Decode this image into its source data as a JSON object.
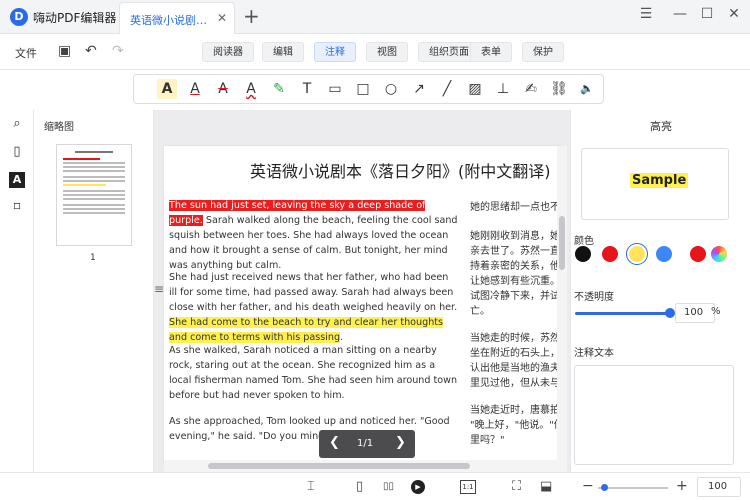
{
  "app": {
    "name": "嗨动PDF编辑器",
    "logo": "D"
  },
  "tab": {
    "title": "英语微小说剧本.p...",
    "close": "✕",
    "new_tab": "+"
  },
  "window": {
    "menu": "☰",
    "minimize": "—",
    "maximize": "☐",
    "close": "✕"
  },
  "menubar": {
    "file": "文件",
    "save_icon": "▣",
    "undo_icon": "↶",
    "redo_icon": "↷",
    "views": [
      "阅读器",
      "编辑",
      "注释",
      "视图",
      "组织页面",
      "表单",
      "保护"
    ],
    "active_view": "注释"
  },
  "tools": [
    {
      "icon": "A",
      "name": "highlight-tool"
    },
    {
      "icon": "A",
      "name": "underline-tool"
    },
    {
      "icon": "A",
      "name": "strikethrough-tool"
    },
    {
      "icon": "A",
      "name": "squiggly-tool"
    },
    {
      "icon": "✎",
      "name": "pencil-tool"
    },
    {
      "icon": "T",
      "name": "text-tool"
    },
    {
      "icon": "▭",
      "name": "comment-tool"
    },
    {
      "icon": "□",
      "name": "rectangle-tool"
    },
    {
      "icon": "○",
      "name": "circle-tool"
    },
    {
      "icon": "↗",
      "name": "arrow-tool"
    },
    {
      "icon": "╱",
      "name": "line-tool"
    },
    {
      "icon": "▨",
      "name": "image-tool"
    },
    {
      "icon": "⊥",
      "name": "stamp-tool"
    },
    {
      "icon": "✍",
      "name": "signature-tool"
    },
    {
      "icon": "⛓",
      "name": "link-tool"
    },
    {
      "icon": "🔈",
      "name": "audio-tool"
    }
  ],
  "left_sidebar": {
    "icons": [
      "⌕",
      "▯",
      "A",
      "⌑"
    ],
    "thumbnail_title": "缩略图",
    "thumbnail_page": "1"
  },
  "document": {
    "title": "英语微小说剧本《落日夕阳》(附中文翻译)",
    "para1_red": "The sun had just set, leaving the sky a deep shade of purple.",
    "para1_rest": " Sarah walked along the beach, feeling the cool sand squish between her toes. She had always loved the ocean and how it brought a sense of calm. But tonight, her mind was anything but calm.",
    "para2_plain": "She had just received news that her father, who had been ill for some time, had passed away. Sarah had always been close with her father, and his death weighed heavily on her. ",
    "para2_yellow": "She had come to the beach to try and clear her thoughts and come to terms with his passing",
    "para2_end": ".",
    "para3": "As she walked, Sarah noticed a man sitting on a nearby rock, staring out at the ocean. She recognized him as a local fisherman named Tom. She had seen him around town before but had never spoken to him.",
    "para4": "As she approached, Tom looked up and noticed her. \"Good evening,\" he said. \"Do you mind if I sit here?\"",
    "cn_lines": [
      "她的思绪却一点也不",
      "她刚刚收到消息，她",
      "亲去世了。苏然一直",
      "持着亲密的关系，他",
      "让她感到有些沉重。",
      "试图冷静下来，并试",
      "亡。",
      "当她走的时候，苏然",
      "坐在附近的石头上，",
      "认出他是当地的渔夫",
      "里见过他，但从未与",
      "当她走近时，唐慕拍",
      "\"晚上好，\"他说。\"你",
      "里吗？\""
    ]
  },
  "pager": {
    "prev": "❮",
    "text": "1/1",
    "next": "❯"
  },
  "drag_handle": "≡",
  "properties": {
    "title": "高亮",
    "sample": "Sample",
    "color_label": "颜色",
    "colors": [
      "#111111",
      "#e8141b",
      "#ffe45c",
      "#3d86f5",
      "#e8141b"
    ],
    "selected_color": "#ffe45c",
    "opacity_label": "不透明度",
    "opacity": "100",
    "opacity_unit": "%",
    "note_label": "注释文本"
  },
  "statusbar": {
    "fit_icon": "⌶",
    "single_page_icon": "▯",
    "double_page_icon": "▯▯",
    "play_icon": "▶",
    "ratio_label": "1:1",
    "fit_page_icon": "⛶",
    "fit_width_icon": "⬓",
    "zoom_out": "−",
    "zoom_in": "+",
    "zoom": "100",
    "zoom_level": 0.05
  }
}
